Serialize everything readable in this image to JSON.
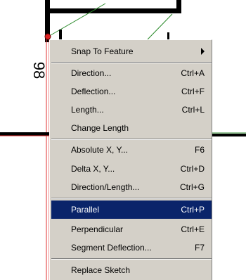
{
  "map": {
    "dimension_label": "98"
  },
  "menu": {
    "items": [
      {
        "label": "Snap To Feature",
        "shortcut": ""
      },
      {
        "label": "Direction...",
        "shortcut": "Ctrl+A"
      },
      {
        "label": "Deflection...",
        "shortcut": "Ctrl+F"
      },
      {
        "label": "Length...",
        "shortcut": "Ctrl+L"
      },
      {
        "label": "Change Length",
        "shortcut": ""
      },
      {
        "label": "Absolute X, Y...",
        "shortcut": "F6"
      },
      {
        "label": "Delta X, Y...",
        "shortcut": "Ctrl+D"
      },
      {
        "label": "Direction/Length...",
        "shortcut": "Ctrl+G"
      },
      {
        "label": "Parallel",
        "shortcut": "Ctrl+P"
      },
      {
        "label": "Perpendicular",
        "shortcut": "Ctrl+E"
      },
      {
        "label": "Segment Deflection...",
        "shortcut": "F7"
      },
      {
        "label": "Replace Sketch",
        "shortcut": ""
      }
    ],
    "highlighted_label": "Parallel"
  }
}
